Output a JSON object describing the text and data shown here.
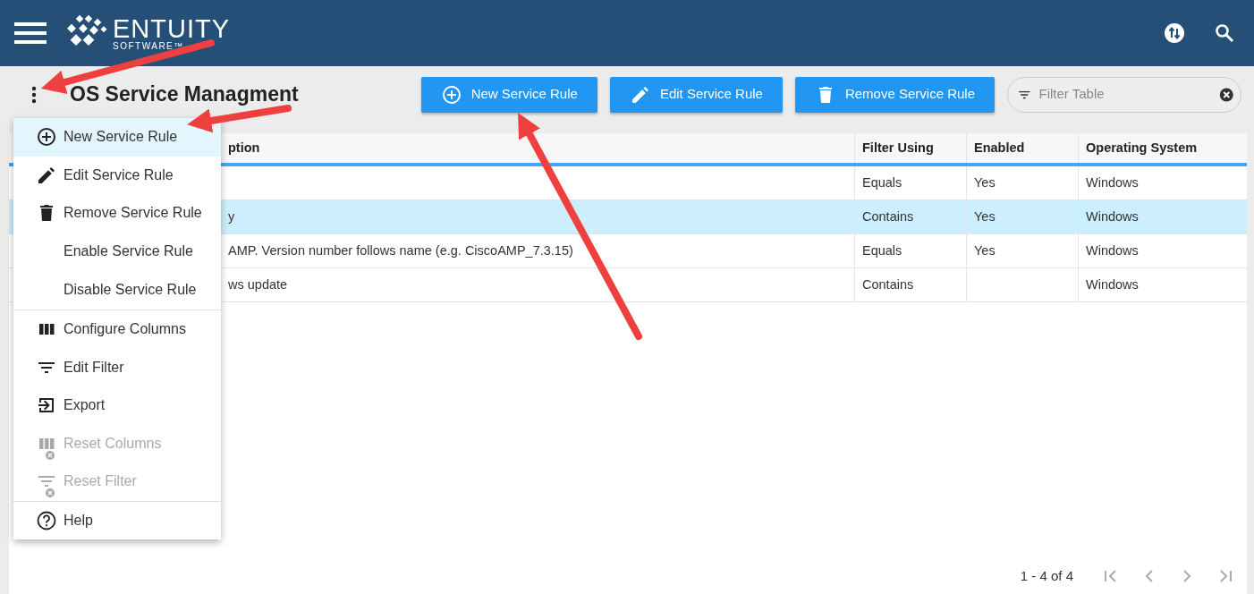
{
  "header": {
    "logo": {
      "name": "ENTUITY",
      "tagline": "SOFTWARE™"
    }
  },
  "page": {
    "title": "OS Service Managment"
  },
  "toolbar": {
    "buttons": [
      {
        "label": "New Service Rule"
      },
      {
        "label": "Edit Service Rule"
      },
      {
        "label": "Remove Service Rule"
      }
    ],
    "filter": {
      "placeholder": "Filter Table"
    }
  },
  "table": {
    "columns": [
      "ption",
      "Filter Using",
      "Enabled",
      "Operating System"
    ],
    "rows": [
      {
        "selected": false,
        "cells": [
          "",
          "Equals",
          "Yes",
          "Windows"
        ]
      },
      {
        "selected": true,
        "cells": [
          "y",
          "Contains",
          "Yes",
          "Windows"
        ]
      },
      {
        "selected": false,
        "cells": [
          "AMP. Version number follows name (e.g. CiscoAMP_7.3.15)",
          "Equals",
          "Yes",
          "Windows"
        ]
      },
      {
        "selected": false,
        "cells": [
          "ws update",
          "Contains",
          "",
          "Windows"
        ]
      }
    ]
  },
  "menu": {
    "groups": [
      [
        {
          "label": "New Service Rule",
          "selected": true,
          "disabled": false
        },
        {
          "label": "Edit Service Rule",
          "selected": false,
          "disabled": false
        },
        {
          "label": "Remove Service Rule",
          "selected": false,
          "disabled": false
        },
        {
          "label": "Enable Service Rule",
          "selected": false,
          "disabled": false
        },
        {
          "label": "Disable Service Rule",
          "selected": false,
          "disabled": false
        }
      ],
      [
        {
          "label": "Configure Columns",
          "selected": false,
          "disabled": false
        },
        {
          "label": "Edit Filter",
          "selected": false,
          "disabled": false
        },
        {
          "label": "Export",
          "selected": false,
          "disabled": false
        },
        {
          "label": "Reset Columns",
          "selected": false,
          "disabled": true
        },
        {
          "label": "Reset Filter",
          "selected": false,
          "disabled": true
        }
      ],
      [
        {
          "label": "Help",
          "selected": false,
          "disabled": false
        }
      ]
    ]
  },
  "pagination": {
    "range": "1 - 4 of 4"
  }
}
